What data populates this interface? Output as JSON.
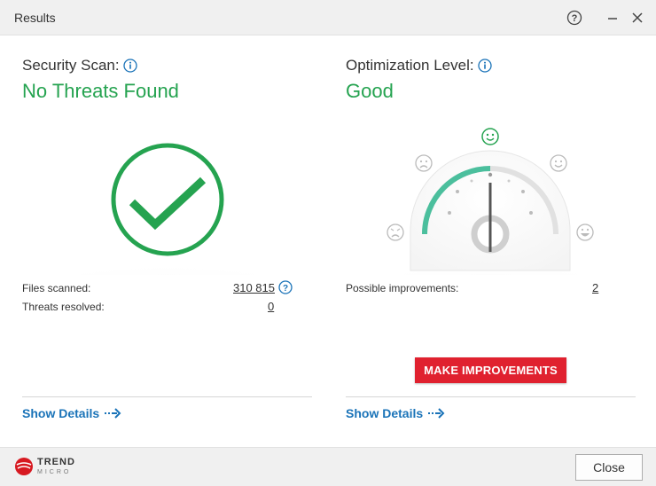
{
  "window": {
    "title": "Results"
  },
  "security": {
    "heading": "Security Scan:",
    "status": "No Threats Found",
    "files_scanned_label": "Files scanned:",
    "files_scanned_value": "310 815",
    "threats_resolved_label": "Threats resolved:",
    "threats_resolved_value": "0",
    "show_details": "Show Details"
  },
  "optimization": {
    "heading": "Optimization Level:",
    "status": "Good",
    "gauge_level": 0.5,
    "possible_improvements_label": "Possible improvements:",
    "possible_improvements_value": "2",
    "make_improvements": "MAKE IMPROVEMENTS",
    "show_details": "Show Details"
  },
  "footer": {
    "brand_line1": "TREND",
    "brand_line2": "MICRO",
    "close_label": "Close"
  },
  "colors": {
    "status_green": "#25a350",
    "gauge_teal": "#4bbf9d",
    "link_blue": "#1a73b8",
    "action_red": "#e0212f",
    "brand_red": "#d71921"
  }
}
